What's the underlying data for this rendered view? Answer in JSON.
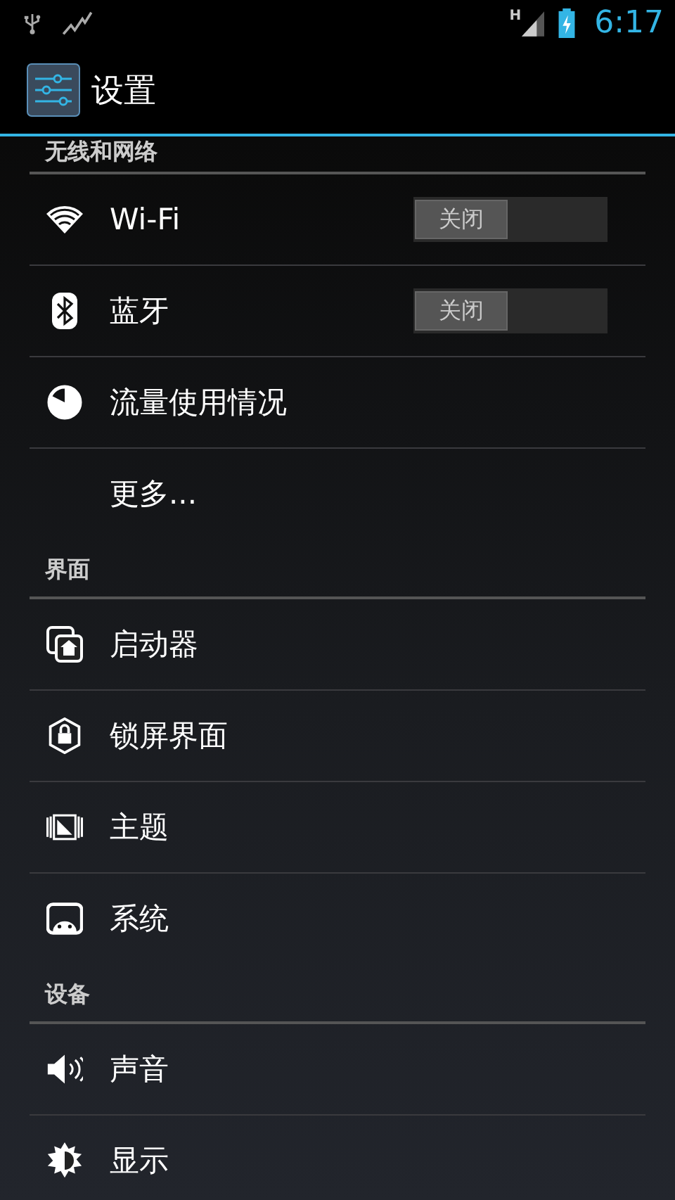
{
  "status_bar": {
    "network_type": "H",
    "time": "6:17"
  },
  "action_bar": {
    "title": "设置"
  },
  "sections": [
    {
      "title": "无线和网络",
      "items": [
        {
          "label": "Wi-Fi",
          "kind": "switch",
          "switch": {
            "text": "关闭",
            "on": false
          }
        },
        {
          "label": "蓝牙",
          "kind": "switch",
          "switch": {
            "text": "关闭",
            "on": false
          }
        },
        {
          "label": "流量使用情况",
          "kind": "plain"
        },
        {
          "label": "更多...",
          "kind": "plain"
        }
      ]
    },
    {
      "title": "界面",
      "items": [
        {
          "label": "启动器",
          "kind": "plain"
        },
        {
          "label": "锁屏界面",
          "kind": "plain"
        },
        {
          "label": "主题",
          "kind": "plain"
        },
        {
          "label": "系统",
          "kind": "plain"
        }
      ]
    },
    {
      "title": "设备",
      "items": [
        {
          "label": "声音",
          "kind": "plain"
        },
        {
          "label": "显示",
          "kind": "plain"
        }
      ]
    }
  ]
}
